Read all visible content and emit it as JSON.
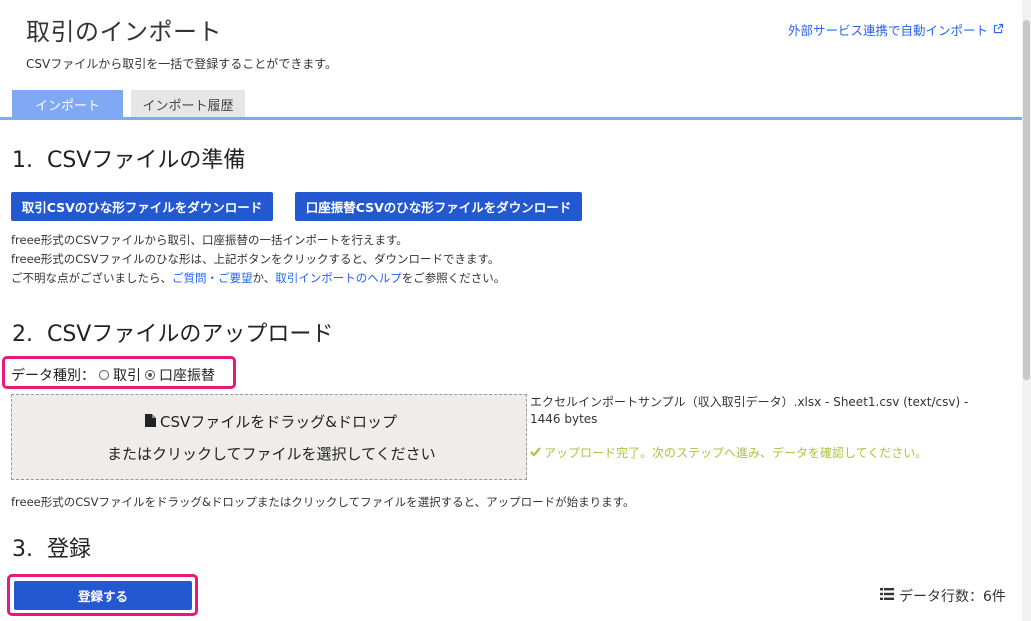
{
  "header": {
    "title": "取引のインポート",
    "subtitle": "CSVファイルから取引を一括で登録することができます。",
    "external_link": "外部サービス連携で自動インポート"
  },
  "tabs": [
    {
      "label": "インポート",
      "active": true
    },
    {
      "label": "インポート履歴",
      "active": false
    }
  ],
  "section1": {
    "heading": "1.  CSVファイルの準備",
    "btn_torihiki": "取引CSVのひな形ファイルをダウンロード",
    "btn_koza": "口座振替CSVのひな形ファイルをダウンロード",
    "desc1": "freee形式のCSVファイルから取引、口座振替の一括インポートを行えます。",
    "desc2": "freee形式のCSVファイルのひな形は、上記ボタンをクリックすると、ダウンロードできます。",
    "desc3_pre": "ご不明な点がございましたら、",
    "desc3_link1": "ご質問・ご要望",
    "desc3_mid": "か、",
    "desc3_link2": "取引インポートのヘルプ",
    "desc3_post": "をご参照ください。"
  },
  "section2": {
    "heading": "2.  CSVファイルのアップロード",
    "datatype_label": "データ種別：",
    "option_torihiki": "取引",
    "option_koza": "口座振替",
    "selected": "口座振替",
    "dropzone_line1": "CSVファイルをドラッグ&ドロップ",
    "dropzone_line2": "またはクリックしてファイルを選択してください",
    "file_info": "エクセルインポートサンプル（収入取引データ）.xlsx - Sheet1.csv (text/csv) - 1446 bytes",
    "success_msg": "アップロード完了。次のステップへ進み、データを確認してください。",
    "note": "freee形式のCSVファイルをドラッグ&ドロップまたはクリックしてファイルを選択すると、アップロードが始まります。"
  },
  "section3": {
    "heading": "3.  登録",
    "register_btn": "登録する",
    "row_count": "データ行数：6件"
  },
  "colors": {
    "primary": "#2458d0",
    "tab_active": "#7fa8f5",
    "highlight": "#e8197a",
    "success": "#a9c33e",
    "link": "#2864f0"
  },
  "icons": [
    "external-link-icon",
    "file-icon",
    "check-icon",
    "list-icon"
  ]
}
